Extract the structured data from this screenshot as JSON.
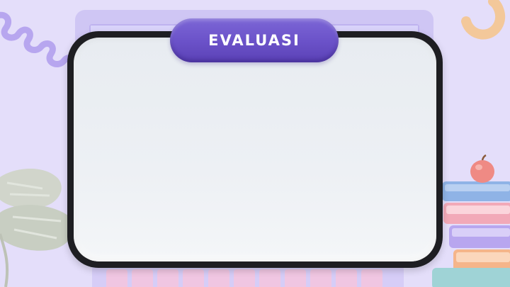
{
  "slide": {
    "title": "EVALUASI"
  },
  "colors": {
    "background": "#e4defa",
    "title_pill": "#6a51c8",
    "board_frame": "#1e1e22",
    "board_fill": "#ecf0f3"
  },
  "decorations": [
    "laptop-illustration",
    "wavy-line",
    "ring-shape",
    "monstera-leaf",
    "apple",
    "book-stack",
    "keyboard-keys"
  ]
}
